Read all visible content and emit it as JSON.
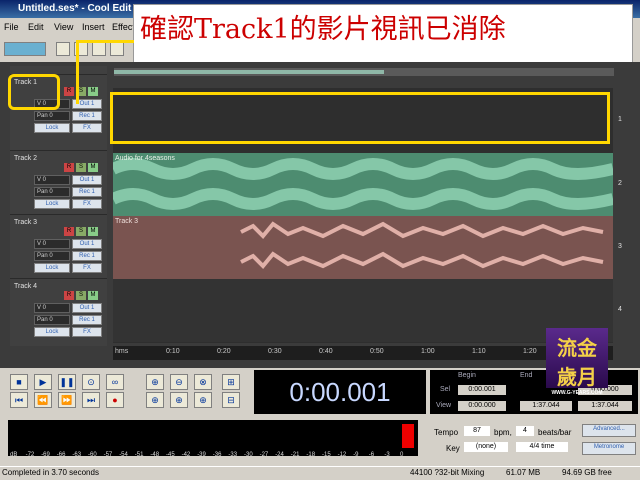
{
  "window": {
    "title": "Untitled.ses* - Cool Edit Pro"
  },
  "menu": {
    "items": [
      "File",
      "Edit",
      "View",
      "Insert",
      "Effects"
    ]
  },
  "caption": {
    "text": "確認Track1的影片視訊已消除"
  },
  "tracks": [
    {
      "name": "Track 1",
      "volume": "V 0",
      "pan": "Pan 0",
      "out": "Out 1",
      "rec": "Rec 1",
      "lock": "Lock",
      "fx": "FX",
      "clip_label": "",
      "color": "#3b3b3b"
    },
    {
      "name": "Track 2",
      "volume": "V 0",
      "pan": "Pan 0",
      "out": "Out 1",
      "rec": "Rec 1",
      "lock": "Lock",
      "fx": "FX",
      "clip_label": "Audio for 4seasons",
      "color": "#4d8c70"
    },
    {
      "name": "Track 3",
      "volume": "V 0",
      "pan": "Pan 0",
      "out": "Out 1",
      "rec": "Rec 1",
      "lock": "Lock",
      "fx": "FX",
      "clip_label": "Track 3",
      "color": "#7a5450"
    },
    {
      "name": "Track 4",
      "volume": "V 0",
      "pan": "Pan 0",
      "out": "Out 1",
      "rec": "Rec 1",
      "lock": "Lock",
      "fx": "FX",
      "clip_label": "",
      "color": "#333333"
    }
  ],
  "rsm_labels": [
    "R",
    "S",
    "M"
  ],
  "ruler": {
    "ticks": [
      "hms",
      "0:10",
      "0:20",
      "0:30",
      "0:40",
      "0:50",
      "1:00",
      "1:10",
      "1:20"
    ]
  },
  "transport": {
    "time": "0:00.001",
    "begin_label": "Begin",
    "end_label": "End",
    "sel_label": "Sel",
    "sel_begin": "0:00.001",
    "sel_end": "0:00.000",
    "view_label": "View",
    "view_begin": "0:00.000",
    "view_end": "1:37.044",
    "view_length": "1:37.044"
  },
  "levels": {
    "ticks": [
      "dB",
      "-72",
      "-69",
      "-66",
      "-63",
      "-60",
      "-57",
      "-54",
      "-51",
      "-48",
      "-45",
      "-42",
      "-39",
      "-36",
      "-33",
      "-30",
      "-27",
      "-24",
      "-21",
      "-18",
      "-15",
      "-12",
      "-9",
      "-6",
      "-3",
      "0"
    ]
  },
  "tempo": {
    "tempo_label": "Tempo",
    "tempo_value": "87",
    "bpm_label": "bpm,",
    "beats_value": "4",
    "beats_label": "beats/bar",
    "advanced_label": "Advanced...",
    "key_label": "Key",
    "key_value": "(none)",
    "time_sig": "4/4 time",
    "metronome_label": "Metronome"
  },
  "status": {
    "message": "Completed in 3.70 seconds",
    "format": "44100 ?32-bit Mixing",
    "size": "61.07 MB",
    "free": "94.69 GB free"
  },
  "logo": {
    "line1": "流金",
    "line2": "歲月",
    "url": "WWW.G-YEARS.COM"
  },
  "colors": {
    "highlight": "#ffd700",
    "caption_text": "#cc0000",
    "track2_wave": "#4d8c70",
    "track3_wave": "#7a5450"
  }
}
